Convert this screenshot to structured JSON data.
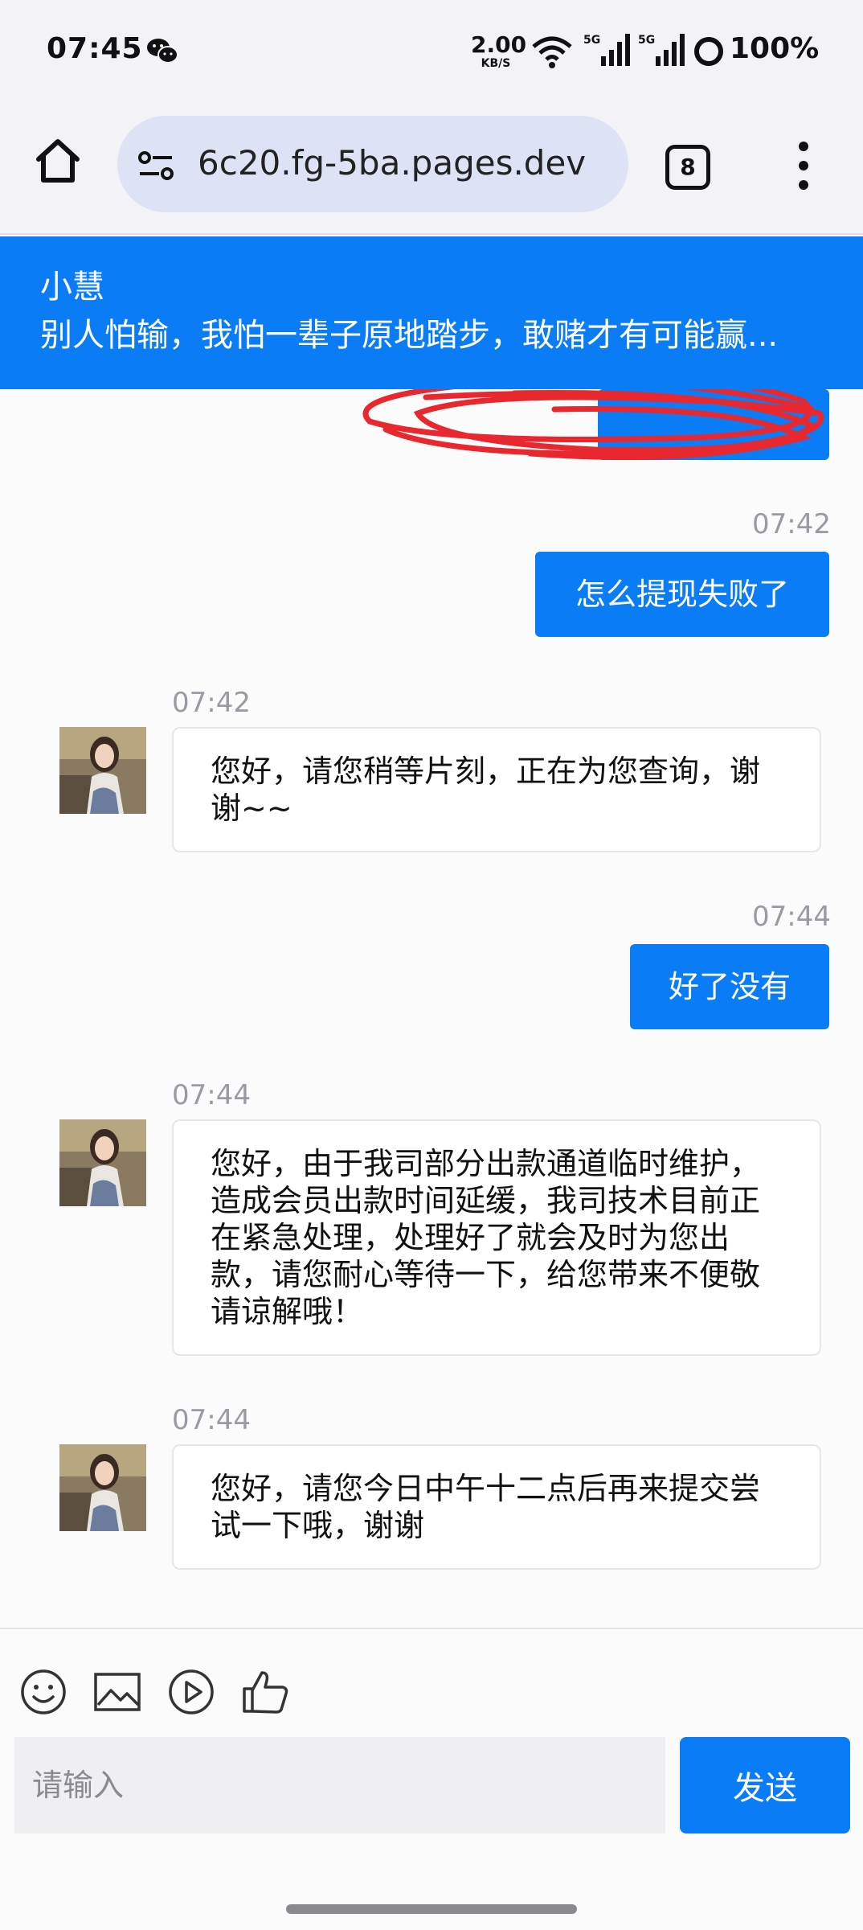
{
  "status_bar": {
    "time": "07:45",
    "net_speed_value": "2.00",
    "net_speed_unit": "KB/S",
    "signal_1_label": "5G",
    "signal_2_label": "5G",
    "battery": "100%"
  },
  "browser": {
    "url": "6c20.fg-5ba.pages.dev",
    "tab_count": "8"
  },
  "chat_header": {
    "name": "小慧",
    "signature": "别人怕输，我怕一辈子原地踏步，敢赌才有可能赢..."
  },
  "messages": [
    {
      "side": "out",
      "text": "怎么提现失败了",
      "time": "07:42"
    },
    {
      "side": "in",
      "text": "您好，请您稍等片刻，正在为您查询，谢谢~~",
      "time": "07:42"
    },
    {
      "side": "out",
      "text": "好了没有",
      "time": "07:44"
    },
    {
      "side": "in",
      "text": "您好，由于我司部分出款通道临时维护，造成会员出款时间延缓，我司技术目前正在紧急处理，处理好了就会及时为您出款，请您耐心等待一下，给您带来不便敬请谅解哦！",
      "time": "07:44"
    },
    {
      "side": "in",
      "text": "您好，请您今日中午十二点后再来提交尝试一下哦，谢谢",
      "time": "07:44"
    }
  ],
  "composer": {
    "placeholder": "请输入",
    "send_label": "发送"
  },
  "colors": {
    "accent": "#0a7cf5",
    "scribble": "#e8282e"
  }
}
